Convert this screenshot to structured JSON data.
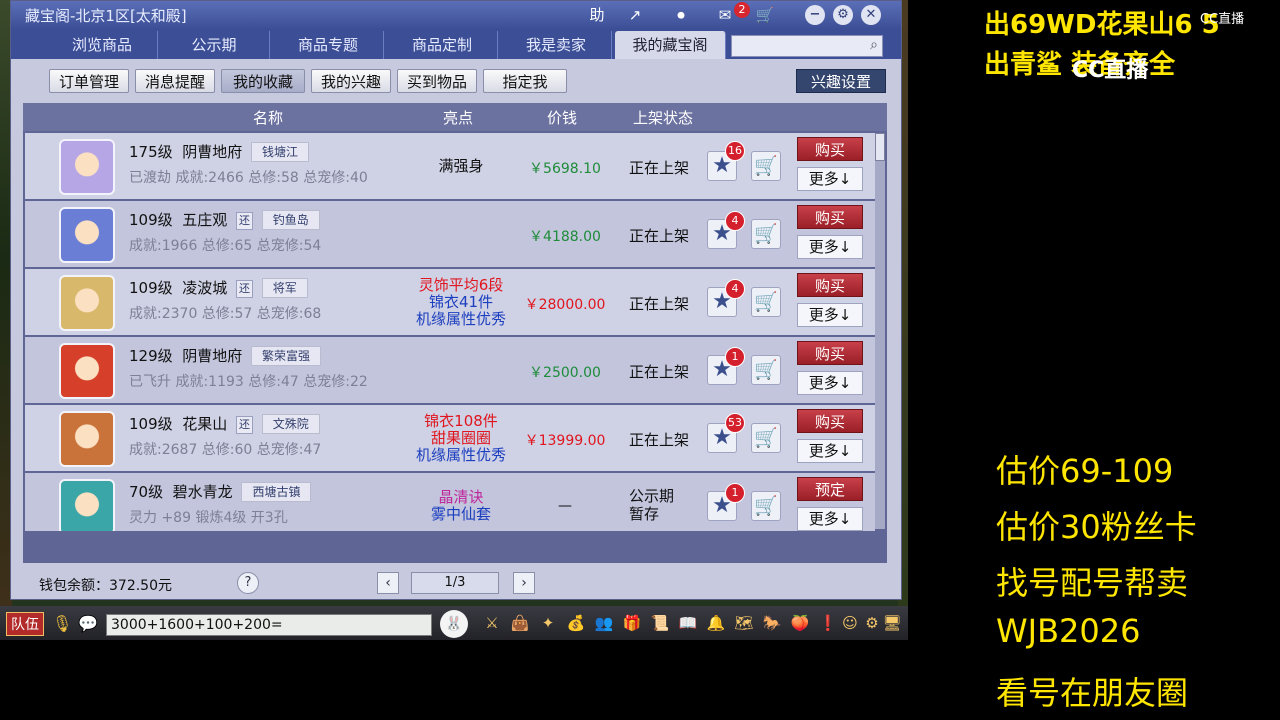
{
  "window": {
    "title": "藏宝阁-北京1区[太和殿]",
    "help_label": "助",
    "msg_badge": "2"
  },
  "tabs": [
    "浏览商品",
    "公示期",
    "商品专题",
    "商品定制",
    "我是卖家",
    "我的藏宝阁"
  ],
  "active_tab": "我的藏宝阁",
  "search": {
    "placeholder": ""
  },
  "subtabs": [
    "订单管理",
    "消息提醒",
    "我的收藏",
    "我的兴趣",
    "买到物品",
    "指定我"
  ],
  "active_subtab": "我的收藏",
  "interest_settings": "兴趣设置",
  "columns": {
    "name": "名称",
    "highlight": "亮点",
    "price": "价钱",
    "status": "上架状态"
  },
  "rows": [
    {
      "level": "175级",
      "school": "阴曹地府",
      "huan": "",
      "server": "钱塘江",
      "info": "已渡劫 成就:2466 总修:58 总宠修:40",
      "highlights": [
        {
          "text": "满强身",
          "color": "#111111"
        }
      ],
      "price": "￥5698.10",
      "price_color": "#1e8c3a",
      "status": "正在上架",
      "fav_count": "16",
      "action": "购买",
      "more": "更多↓",
      "avatar_color": "#b6a6e6"
    },
    {
      "level": "109级",
      "school": "五庄观",
      "huan": "还",
      "server": "钓鱼岛",
      "info": "成就:1966 总修:65 总宠修:54",
      "highlights": [],
      "price": "￥4188.00",
      "price_color": "#1e8c3a",
      "status": "正在上架",
      "fav_count": "4",
      "action": "购买",
      "more": "更多↓",
      "avatar_color": "#6a7ed6"
    },
    {
      "level": "109级",
      "school": "凌波城",
      "huan": "还",
      "server": "将军",
      "info": "成就:2370 总修:57 总宠修:68",
      "highlights": [
        {
          "text": "灵饰平均6段",
          "color": "#e0161e"
        },
        {
          "text": "锦衣41件",
          "color": "#1c3fbf"
        },
        {
          "text": "机缘属性优秀",
          "color": "#1c3fbf"
        }
      ],
      "price": "￥28000.00",
      "price_color": "#e0161e",
      "status": "正在上架",
      "fav_count": "4",
      "action": "购买",
      "more": "更多↓",
      "avatar_color": "#d8b86a"
    },
    {
      "level": "129级",
      "school": "阴曹地府",
      "huan": "",
      "server": "繁荣富强",
      "info": "已飞升 成就:1193 总修:47 总宠修:22",
      "highlights": [],
      "price": "￥2500.00",
      "price_color": "#1e8c3a",
      "status": "正在上架",
      "fav_count": "1",
      "action": "购买",
      "more": "更多↓",
      "avatar_color": "#d6402a"
    },
    {
      "level": "109级",
      "school": "花果山",
      "huan": "还",
      "server": "文殊院",
      "info": "成就:2687 总修:60 总宠修:47",
      "highlights": [
        {
          "text": "锦衣108件",
          "color": "#e0161e"
        },
        {
          "text": "甜果圈圈",
          "color": "#e0161e"
        },
        {
          "text": "机缘属性优秀",
          "color": "#1c3fbf"
        }
      ],
      "price": "￥13999.00",
      "price_color": "#e0161e",
      "status": "正在上架",
      "fav_count": "53",
      "action": "购买",
      "more": "更多↓",
      "avatar_color": "#c9733a"
    },
    {
      "level": "70级",
      "school": "碧水青龙",
      "huan": "",
      "server": "西塘古镇",
      "info": "灵力 +89 锻炼4级 开3孔",
      "highlights": [
        {
          "text": "晶清诀",
          "color": "#c0269c"
        },
        {
          "text": "雾中仙套",
          "color": "#1c3fbf"
        }
      ],
      "price": "—",
      "price_color": "#111111",
      "status": "公示期\n暂存",
      "fav_count": "1",
      "action": "预定",
      "more": "更多↓",
      "avatar_color": "#3aa6a8"
    }
  ],
  "footer": {
    "wallet": "钱包余额：372.50元",
    "page": "1/3",
    "help": "?"
  },
  "gamebar": {
    "team": "队伍",
    "chat_input": "3000+1600+100+200="
  },
  "overlay": {
    "top_line1": "出69WD花果山6 5",
    "top_line2": "出青鲨 装备齐全",
    "cc_logo": "CC直播",
    "cc_logo_small": "CC直播",
    "side_lines": [
      "估价69-109",
      "估价30粉丝卡",
      "找号配号帮卖",
      " WJB2026",
      "看号在朋友圈"
    ]
  },
  "colors": {
    "accent": "#3c4f96",
    "buy": "#b02a33",
    "overlay_text": "#ffe600"
  }
}
